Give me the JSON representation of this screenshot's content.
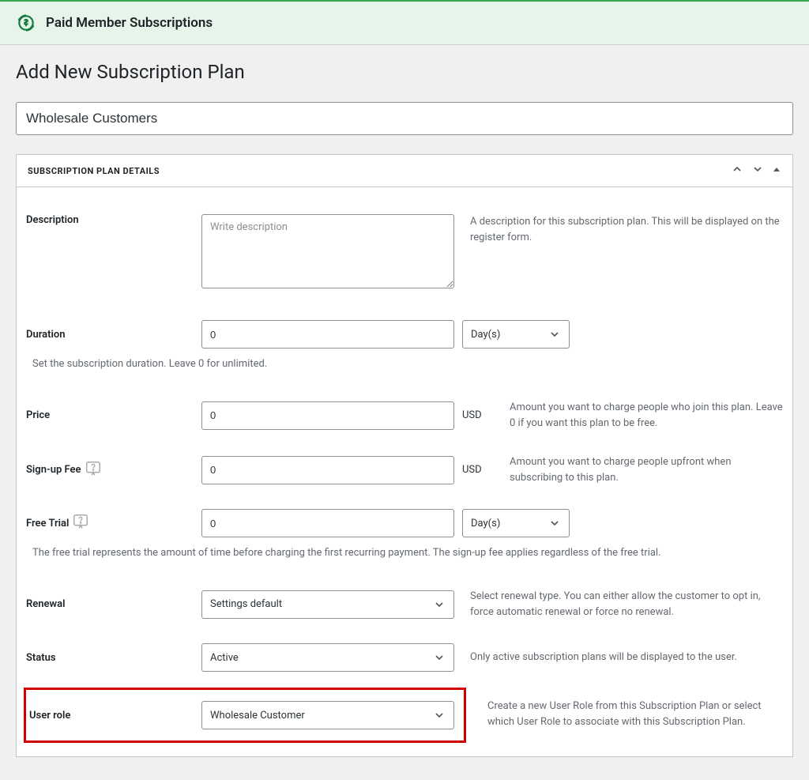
{
  "header": {
    "brand": "Paid Member Subscriptions"
  },
  "page": {
    "title": "Add New Subscription Plan"
  },
  "titleField": {
    "value": "Wholesale Customers"
  },
  "metabox": {
    "title": "SUBSCRIPTION PLAN DETAILS"
  },
  "fields": {
    "description": {
      "label": "Description",
      "placeholder": "Write description",
      "help": "A description for this subscription plan. This will be displayed on the register form."
    },
    "duration": {
      "label": "Duration",
      "value": "0",
      "unit": "Day(s)",
      "note": "Set the subscription duration. Leave 0 for unlimited."
    },
    "price": {
      "label": "Price",
      "value": "0",
      "currency": "USD",
      "help": "Amount you want to charge people who join this plan. Leave 0 if you want this plan to be free."
    },
    "signup": {
      "label": "Sign-up Fee",
      "value": "0",
      "currency": "USD",
      "help": "Amount you want to charge people upfront when subscribing to this plan."
    },
    "trial": {
      "label": "Free Trial",
      "value": "0",
      "unit": "Day(s)",
      "note": "The free trial represents the amount of time before charging the first recurring payment. The sign-up fee applies regardless of the free trial."
    },
    "renewal": {
      "label": "Renewal",
      "value": "Settings default",
      "help": "Select renewal type. You can either allow the customer to opt in, force automatic renewal or force no renewal."
    },
    "status": {
      "label": "Status",
      "value": "Active",
      "help": "Only active subscription plans will be displayed to the user."
    },
    "userrole": {
      "label": "User role",
      "value": "Wholesale Customer",
      "help": "Create a new User Role from this Subscription Plan or select which User Role to associate with this Subscription Plan."
    }
  }
}
